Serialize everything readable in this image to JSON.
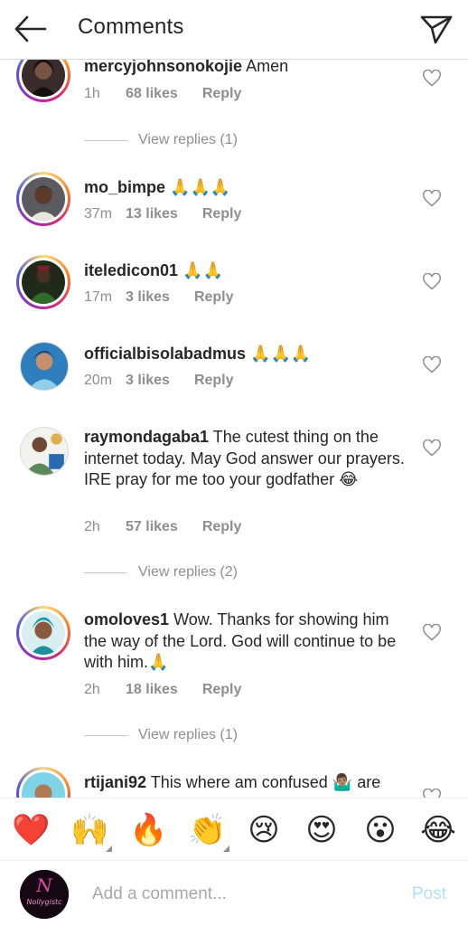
{
  "header": {
    "title": "Comments",
    "back_icon": "arrow-left-icon",
    "send_icon": "paper-plane-icon"
  },
  "comments": [
    {
      "username": "mercyjohnsonokojie",
      "text": "Amen",
      "time": "1h",
      "likes": "68 likes",
      "reply": "Reply",
      "view_replies": "View replies (1)"
    },
    {
      "username": "mo_bimpe",
      "text": "🙏🙏🙏",
      "time": "37m",
      "likes": "13 likes",
      "reply": "Reply"
    },
    {
      "username": "iteledicon01",
      "text": "🙏🙏",
      "time": "17m",
      "likes": "3 likes",
      "reply": "Reply"
    },
    {
      "username": "officialbisolabadmus",
      "text": "🙏🙏🙏",
      "time": "20m",
      "likes": "3 likes",
      "reply": "Reply"
    },
    {
      "username": "raymondagaba1",
      "text": "The cutest thing on the internet today. May God answer our prayers. IRE pray for me too your godfather 😂",
      "time": "2h",
      "likes": "57 likes",
      "reply": "Reply",
      "view_replies": "View replies (2)"
    },
    {
      "username": "omoloves1",
      "text": "Wow. Thanks for showing him the way of the Lord. God will continue to be with him.🙏",
      "time": "2h",
      "likes": "18 likes",
      "reply": "Reply",
      "view_replies": "View replies (1)"
    },
    {
      "username": "rtijani92",
      "text": "This where am confused 🤷🏽‍♂️ are"
    }
  ],
  "emoji_bar": [
    "❤️",
    "🙌",
    "🔥",
    "👏",
    "😢",
    "😍",
    "😮",
    "😂"
  ],
  "composer": {
    "placeholder": "Add a comment...",
    "post_label": "Post",
    "avatar_text": "Nollygistc"
  }
}
